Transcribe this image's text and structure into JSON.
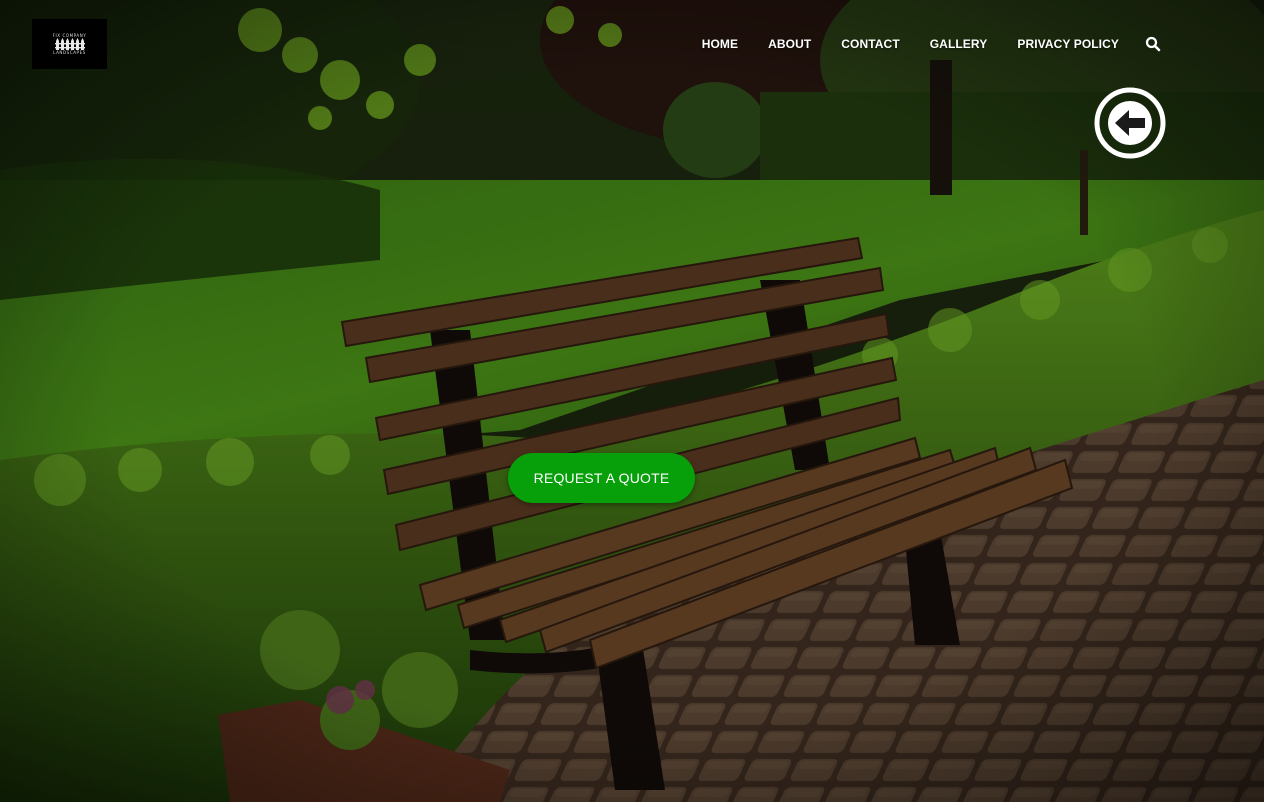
{
  "header": {
    "logo_line1": "FIX COMPANY",
    "logo_line2": "LANDSCAPES"
  },
  "nav": {
    "items": [
      {
        "label": "HOME"
      },
      {
        "label": "ABOUT"
      },
      {
        "label": "CONTACT"
      },
      {
        "label": "GALLERY"
      },
      {
        "label": "PRIVACY POLICY"
      }
    ],
    "search_icon": "search-icon"
  },
  "hero": {
    "background_image": "park-bench-photo",
    "back_icon": "arrow-left-circle-icon",
    "cta_label": "REQUEST A QUOTE"
  },
  "colors": {
    "cta_bg": "#07a00a",
    "nav_text": "#ffffff"
  }
}
